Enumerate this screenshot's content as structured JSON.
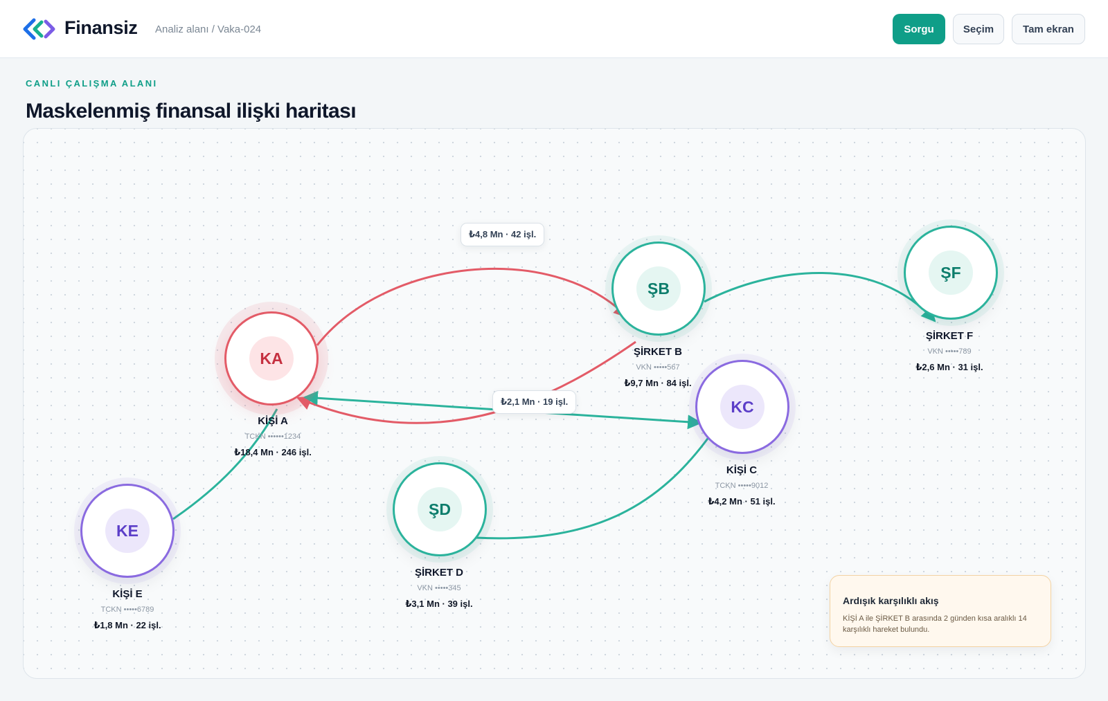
{
  "header": {
    "brand": "Finansiz",
    "breadcrumb": "Analiz alanı / Vaka-024",
    "buttons": {
      "query": "Sorgu",
      "select": "Seçim",
      "fullscreen": "Tam ekran"
    }
  },
  "page": {
    "eyebrow": "CANLI ÇALIŞMA ALANI",
    "title": "Maskelenmiş finansal ilişki haritası"
  },
  "colors": {
    "accent": "#0f9e88",
    "outflow_edge": "#e35b67",
    "flow_edge": "#2bb39c",
    "person_node": "#8a6ae0"
  },
  "graph": {
    "nodes": {
      "ka": {
        "initials": "KA",
        "name": "KİŞİ A",
        "id_masked": "TCKN ••••••1234",
        "summary": "₺18,4 Mn · 246 işl.",
        "kind": "person-flagged"
      },
      "sb": {
        "initials": "ŞB",
        "name": "ŞİRKET B",
        "id_masked": "VKN •••••567",
        "summary": "₺9,7 Mn · 84 işl.",
        "kind": "company"
      },
      "sf": {
        "initials": "ŞF",
        "name": "ŞİRKET F",
        "id_masked": "VKN •••••789",
        "summary": "₺2,6 Mn · 31 işl.",
        "kind": "company"
      },
      "kc": {
        "initials": "KC",
        "name": "KİŞİ C",
        "id_masked": "TCKN •••••9012",
        "summary": "₺4,2 Mn · 51 işl.",
        "kind": "person"
      },
      "sd": {
        "initials": "ŞD",
        "name": "ŞİRKET D",
        "id_masked": "VKN •••••345",
        "summary": "₺3,1 Mn · 39 işl.",
        "kind": "company"
      },
      "ke": {
        "initials": "KE",
        "name": "KİŞİ E",
        "id_masked": "TCKN •••••6789",
        "summary": "₺1,8 Mn · 22 işl.",
        "kind": "person"
      }
    },
    "edges": [
      {
        "from": "KA",
        "to": "ŞB",
        "label": "₺4,8 Mn · 42 işl.",
        "color": "red"
      },
      {
        "from": "ŞB",
        "to": "KA",
        "color": "red"
      },
      {
        "from": "KC",
        "to": "KA",
        "label": "₺2,1 Mn · 19 işl.",
        "color": "teal"
      },
      {
        "from": "ŞB",
        "to": "ŞF",
        "color": "teal"
      },
      {
        "from": "ŞD",
        "to": "KC",
        "color": "teal"
      },
      {
        "from": "KE",
        "to": "KA",
        "color": "teal"
      }
    ]
  },
  "alert": {
    "title": "Ardışık karşılıklı akış",
    "body": "KİŞİ A ile ŞİRKET B arasında 2 günden kısa aralıklı 14 karşılıklı hareket bulundu."
  }
}
